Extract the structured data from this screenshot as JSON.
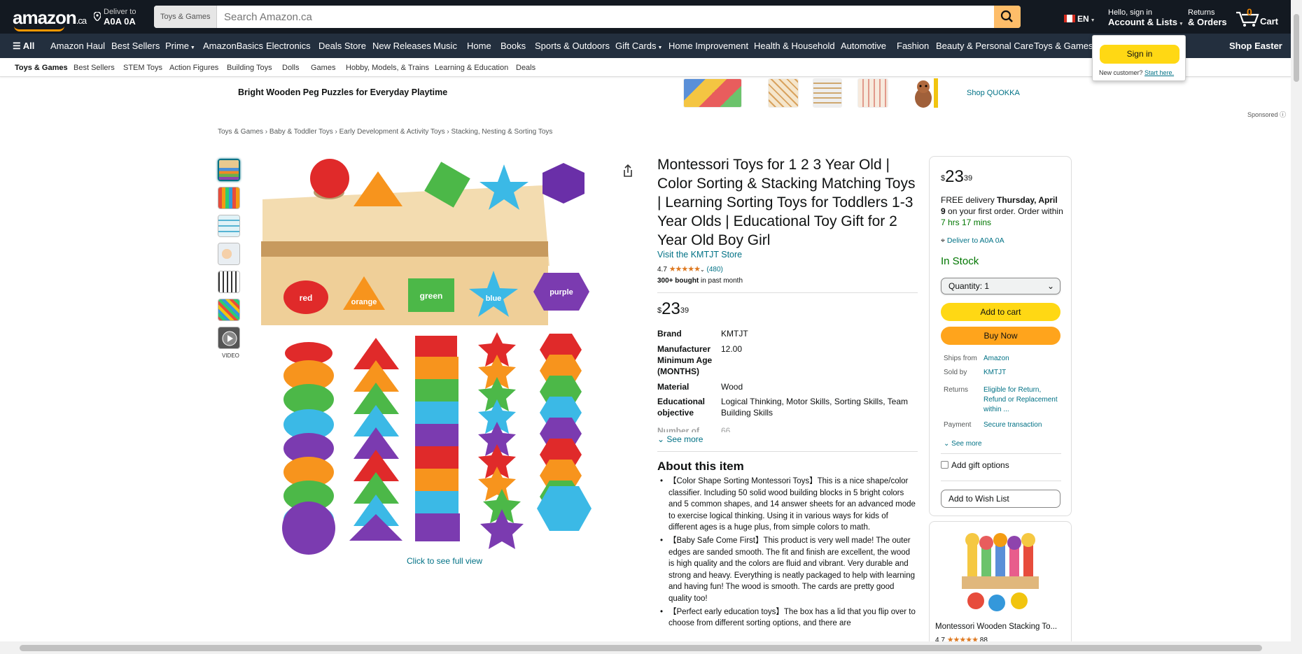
{
  "header": {
    "logo_text": "amazon",
    "logo_suffix": ".ca",
    "deliver_line1": "Deliver to",
    "deliver_line2": "A0A 0A",
    "search_category": "Toys & Games",
    "search_placeholder": "Search Amazon.ca",
    "language": "EN",
    "account_line1": "Hello, sign in",
    "account_line2": "Account & Lists",
    "returns_line1": "Returns",
    "returns_line2": "& Orders",
    "cart_count": "0",
    "cart_label": "Cart"
  },
  "nav": {
    "all": "All",
    "items": [
      "Amazon Haul",
      "Best Sellers",
      "Prime",
      "AmazonBasics",
      "Electronics",
      "Deals Store",
      "New Releases",
      "Music",
      "Home",
      "Books",
      "Sports & Outdoors",
      "Gift Cards",
      "Home Improvement",
      "Health & Household",
      "Automotive",
      "Fashion",
      "Beauty & Personal Care",
      "Toys & Games"
    ],
    "promo": "Shop Easter"
  },
  "subnav": [
    "Toys & Games",
    "Best Sellers",
    "STEM Toys",
    "Action Figures",
    "Building Toys",
    "Dolls",
    "Games",
    "Hobby, Models, & Trains",
    "Learning & Education",
    "Deals"
  ],
  "signin_popover": {
    "button": "Sign in",
    "new_customer": "New customer?",
    "start_here": "Start here."
  },
  "banner": {
    "headline": "Bright Wooden Peg Puzzles for Everyday Playtime",
    "shop_link": "Shop QUOKKA",
    "sponsored": "Sponsored"
  },
  "breadcrumbs": [
    "Toys & Games",
    "Baby & Toddler Toys",
    "Early Development & Activity Toys",
    "Stacking, Nesting & Sorting Toys"
  ],
  "gallery": {
    "video_label": "VIDEO",
    "full_view": "Click to see full view",
    "box_labels": [
      "red",
      "orange",
      "green",
      "blue",
      "purple"
    ]
  },
  "product": {
    "title": "Montessori Toys for 1 2 3 Year Old | Color Sorting & Stacking Matching Toys | Learning Sorting Toys for Toddlers 1-3 Year Olds | Educational Toy Gift for 2 Year Old Boy Girl",
    "store": "Visit the KMTJT Store",
    "rating": "4.7",
    "stars": "★★★★★",
    "review_count": "(480)",
    "bought_bold": "300+ bought",
    "bought_rest": " in past month",
    "price_symbol": "$",
    "price_whole": "23",
    "price_fraction": "39",
    "specs": [
      {
        "key": "Brand",
        "value": "KMTJT"
      },
      {
        "key": "Manufacturer Minimum Age (MONTHS)",
        "value": "12.00"
      },
      {
        "key": "Material",
        "value": "Wood"
      },
      {
        "key": "Educational objective",
        "value": "Logical Thinking, Motor Skills, Sorting Skills, Team Building Skills"
      },
      {
        "key": "Number of",
        "value": "66"
      }
    ],
    "see_more": "See more",
    "about_heading": "About this item",
    "bullets": [
      "【Color Shape Sorting Montessori Toys】This is a nice shape/color classifier. Including 50 solid wood building blocks in 5 bright colors and 5 common shapes, and 14 answer sheets for an advanced mode to exercise logical thinking. Using it in various ways for kids of different ages is a huge plus, from simple colors to math.",
      "【Baby Safe Come First】This product is very well made! The outer edges are sanded smooth. The fit and finish are excellent, the wood is high quality and the colors are fluid and vibrant. Very durable and strong and heavy. Everything is neatly packaged to help with learning and having fun! The wood is smooth. The cards are pretty good quality too!",
      "【Perfect early education toys】The box has a lid that you flip over to choose from different sorting options, and there are"
    ]
  },
  "buybox": {
    "price_symbol": "$",
    "price_whole": "23",
    "price_fraction": "39",
    "delivery_prefix": "FREE delivery ",
    "delivery_date": "Thursday, April 9",
    "delivery_suffix": " on your first order. Order within ",
    "delivery_time": "7 hrs 17 mins",
    "deliver_to": "Deliver to",
    "deliver_code": "A0A 0A",
    "stock": "In Stock",
    "quantity": "Quantity:  1",
    "add_to_cart": "Add to cart",
    "buy_now": "Buy Now",
    "meta": [
      {
        "key": "Ships from",
        "value": "Amazon"
      },
      {
        "key": "Sold by",
        "value": "KMTJT"
      },
      {
        "key": "Returns",
        "value": "Eligible for Return, Refund or Replacement within ..."
      },
      {
        "key": "Payment",
        "value": "Secure transaction"
      }
    ],
    "see_more": "See more",
    "gift_options": "Add gift options",
    "wish_list": "Add to Wish List"
  },
  "ad": {
    "title": "Montessori Wooden Stacking To...",
    "rating": "4.7",
    "stars": "★★★★★",
    "count": "88"
  },
  "colors": {
    "header_bg": "#131921",
    "nav_bg": "#232f3e",
    "accent_orange": "#ff9900",
    "cart_button": "#ffd814",
    "buy_button": "#ffa41c",
    "link": "#007185",
    "in_stock": "#007600"
  }
}
